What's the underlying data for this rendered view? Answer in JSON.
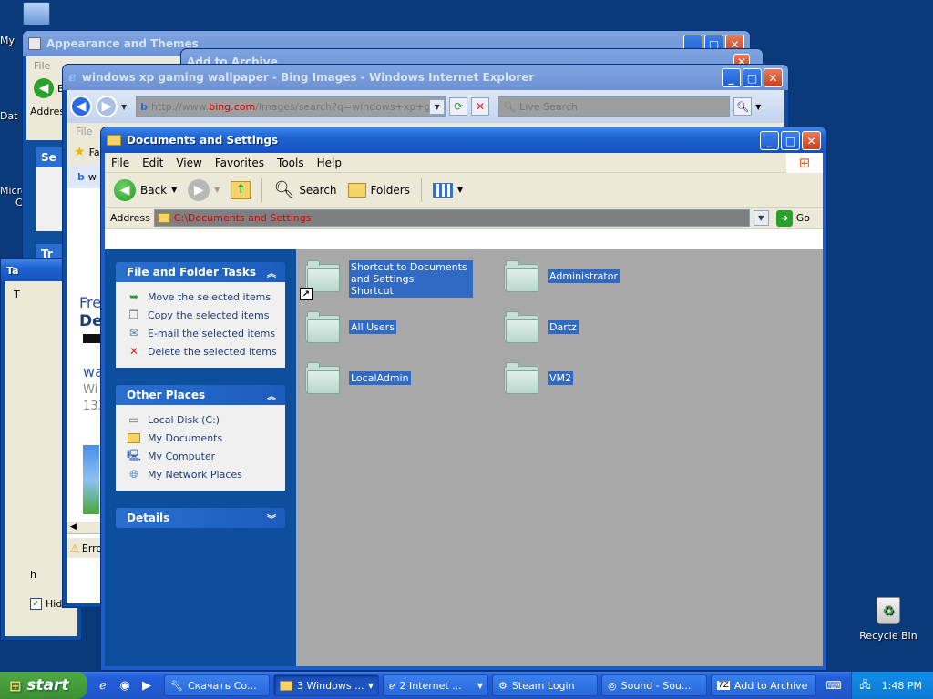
{
  "desktop": {
    "icons": [
      {
        "label": "My",
        "icon": "my-computer-icon"
      },
      {
        "label": "Dat"
      },
      {
        "label": "Micro"
      },
      {
        "label": "C"
      }
    ],
    "recycle_bin": "Recycle Bin"
  },
  "bg_windows": {
    "appearance": {
      "title": "Appearance and Themes",
      "menu_file": "File",
      "address": "Address",
      "back_label": "B",
      "se": "Se",
      "tr": "Tr",
      "ta": "Ta",
      "t": "T",
      "hide_label": "Hide",
      "h": "h"
    },
    "add_archive": {
      "title": "Add to Archive"
    },
    "ie": {
      "title": "windows xp gaming wallpaper - Bing Images - Windows Internet Explorer",
      "url_prefix": "http://www.",
      "url_domain": "bing.com",
      "url_rest": "/images/search?q=windows+xp+gamin",
      "search_placeholder": "Live Search",
      "menu_file": "File",
      "fav": "Fa",
      "w": "w",
      "fre": "Fre",
      "de": "De",
      "wa": "wa",
      "wi": "Wi",
      "num": "133",
      "error": "Erro"
    }
  },
  "doc_window": {
    "title": "Documents and Settings",
    "menu": [
      "File",
      "Edit",
      "View",
      "Favorites",
      "Tools",
      "Help"
    ],
    "toolbar": {
      "back": "Back",
      "search": "Search",
      "folders": "Folders"
    },
    "address_label": "Address",
    "address_value": "C:\\Documents and Settings",
    "go_label": "Go",
    "panels": {
      "file_tasks": {
        "title": "File and Folder Tasks",
        "items": [
          {
            "label": "Move the selected items",
            "icon": "move-icon"
          },
          {
            "label": "Copy the selected items",
            "icon": "copy-icon"
          },
          {
            "label": "E-mail the selected items",
            "icon": "email-icon"
          },
          {
            "label": "Delete the selected items",
            "icon": "delete-icon"
          }
        ]
      },
      "other_places": {
        "title": "Other Places",
        "items": [
          {
            "label": "Local Disk (C:)",
            "icon": "drive-icon"
          },
          {
            "label": "My Documents",
            "icon": "my-documents-icon"
          },
          {
            "label": "My Computer",
            "icon": "my-computer-icon"
          },
          {
            "label": "My Network Places",
            "icon": "network-icon"
          }
        ]
      },
      "details": {
        "title": "Details"
      }
    },
    "items": [
      {
        "label": "Shortcut to Documents and Settings",
        "sub": "Shortcut",
        "shortcut": true
      },
      {
        "label": "Administrator"
      },
      {
        "label": "All Users"
      },
      {
        "label": "Dartz"
      },
      {
        "label": "LocalAdmin"
      },
      {
        "label": "VM2"
      }
    ]
  },
  "taskbar": {
    "start": "start",
    "buttons": [
      {
        "label": "Скачать Со...",
        "icon": "download-icon"
      },
      {
        "label": "3 Windows ...",
        "icon": "folder-icon",
        "active": true,
        "group": true
      },
      {
        "label": "2 Internet ...",
        "icon": "ie-icon",
        "group": true
      },
      {
        "label": "Steam Login",
        "icon": "steam-icon"
      },
      {
        "label": "Sound - Sou...",
        "icon": "sound-icon"
      },
      {
        "label": "Add to Archive",
        "icon": "archive-icon"
      }
    ],
    "clock": "1:48 PM"
  },
  "colors": {
    "selection": "#316ac5",
    "content_bg": "#a8a8a8",
    "sidebar_bg": "#0d4f9c"
  }
}
